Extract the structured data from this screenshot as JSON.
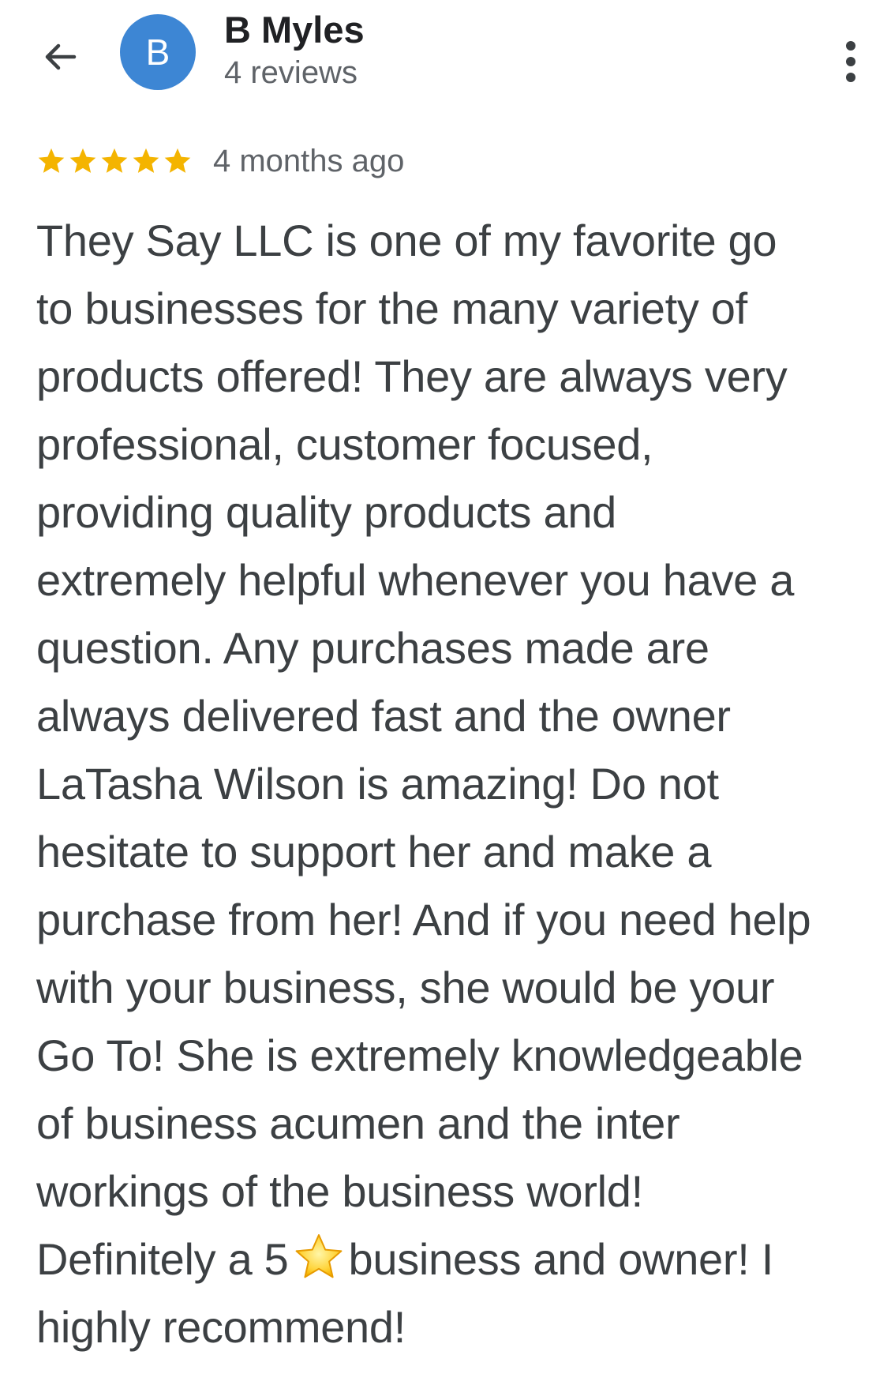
{
  "reviewer": {
    "avatar_letter": "B",
    "avatar_color": "#3d86d4",
    "name": "B Myles",
    "review_count": "4 reviews"
  },
  "header": {
    "back_icon": "arrow-back-icon",
    "more_icon": "more-vert-icon"
  },
  "review": {
    "stars": 5,
    "star_color": "#f4b400",
    "time_ago": "4 months ago",
    "lines": [
      "They Say LLC is one of my favorite go",
      "to businesses for the many variety of",
      "products offered! They are always very",
      "professional, customer focused,",
      "providing quality products and",
      "extremely helpful whenever you have a",
      "question. Any purchases made are",
      "always delivered fast and the owner",
      "LaTasha Wilson is amazing! Do not",
      "hesitate to support her and make a",
      "purchase from her! And if you need help",
      "with your business, she would be your",
      "Go To! She is extremely knowledgeable",
      "of business acumen and the inter",
      "workings of the business world!"
    ],
    "line_16_before": "Definitely a 5",
    "line_16_emoji": "star-emoji",
    "line_16_after": "business and owner! I",
    "line_17": "highly recommend!"
  }
}
